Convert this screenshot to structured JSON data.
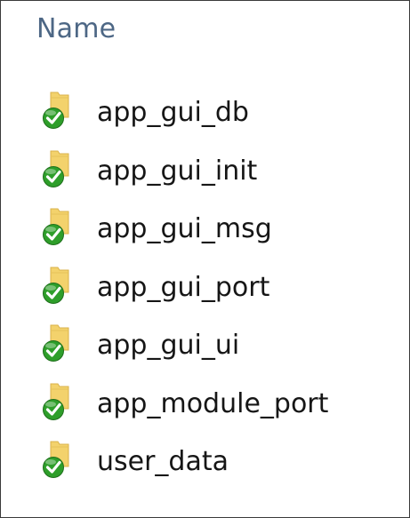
{
  "header": {
    "column_label": "Name"
  },
  "files": [
    {
      "name": "app_gui_db",
      "icon": "folder-synced-icon"
    },
    {
      "name": "app_gui_init",
      "icon": "folder-synced-icon"
    },
    {
      "name": "app_gui_msg",
      "icon": "folder-synced-icon"
    },
    {
      "name": "app_gui_port",
      "icon": "folder-synced-icon"
    },
    {
      "name": "app_gui_ui",
      "icon": "folder-synced-icon"
    },
    {
      "name": "app_module_port",
      "icon": "folder-synced-icon"
    },
    {
      "name": "user_data",
      "icon": "folder-synced-icon"
    }
  ],
  "colors": {
    "header_text": "#4d6785",
    "folder": "#f3d26c",
    "sync_badge": "#2e9e2a"
  }
}
